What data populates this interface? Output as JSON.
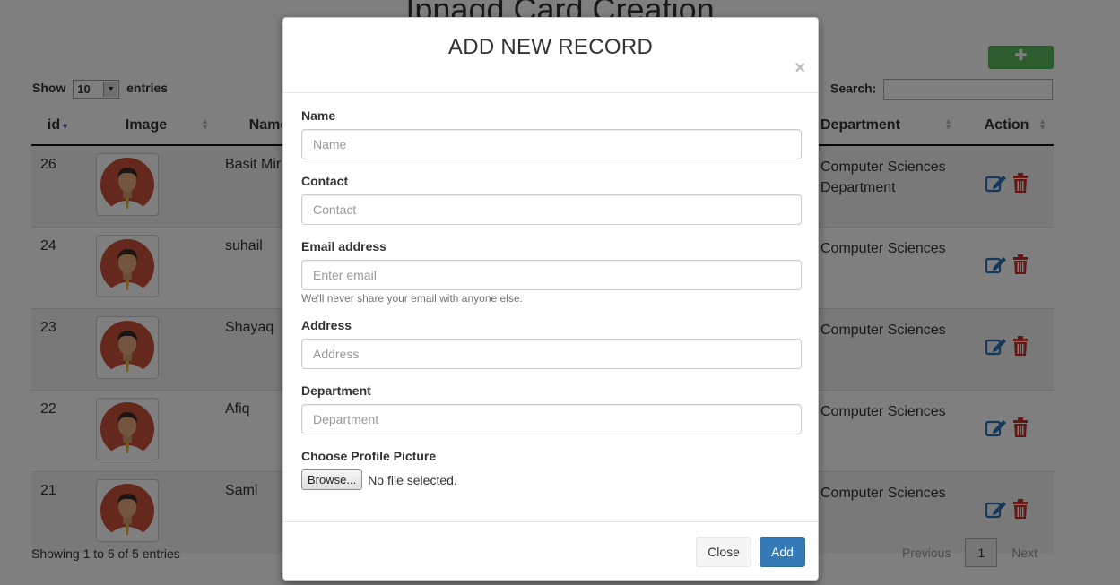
{
  "page": {
    "title": "Ipnaqd Card Creation",
    "add_button": "✚",
    "length": {
      "show": "Show",
      "value": "10",
      "entries": "entries"
    },
    "search_label": "Search:",
    "table": {
      "headers": [
        "id",
        "Image",
        "Name",
        "Department",
        "Action"
      ],
      "rows": [
        {
          "id": "26",
          "name": "Basit Mir",
          "department": "Computer Sciences Department"
        },
        {
          "id": "24",
          "name": "suhail",
          "department": "Computer Sciences"
        },
        {
          "id": "23",
          "name": "Shayaq",
          "department": "Computer Sciences"
        },
        {
          "id": "22",
          "name": "Afiq",
          "department": "Computer Sciences"
        },
        {
          "id": "21",
          "name": "Sami",
          "department": "Computer Sciences"
        }
      ]
    },
    "info": "Showing 1 to 5 of 5 entries",
    "pager": {
      "previous": "Previous",
      "current": "1",
      "next": "Next"
    }
  },
  "modal": {
    "title": "ADD NEW RECORD",
    "close_x": "×",
    "fields": {
      "name": {
        "label": "Name",
        "placeholder": "Name"
      },
      "contact": {
        "label": "Contact",
        "placeholder": "Contact"
      },
      "email": {
        "label": "Email address",
        "placeholder": "Enter email",
        "help": "We'll never share your email with anyone else."
      },
      "address": {
        "label": "Address",
        "placeholder": "Address"
      },
      "department": {
        "label": "Department",
        "placeholder": "Department"
      },
      "picture": {
        "label": "Choose Profile Picture",
        "browse": "Browse...",
        "status": "No file selected."
      }
    },
    "footer": {
      "close": "Close",
      "add": "Add"
    }
  },
  "colors": {
    "primary": "#337ab7",
    "success": "#5cb85c",
    "edit_icon": "#2a6fb3",
    "delete_icon": "#c9302c",
    "backdrop": "rgba(0,0,0,0.5)"
  },
  "icons": {
    "edit": "edit-icon",
    "delete": "trash-icon",
    "sort": "sort-icon"
  }
}
